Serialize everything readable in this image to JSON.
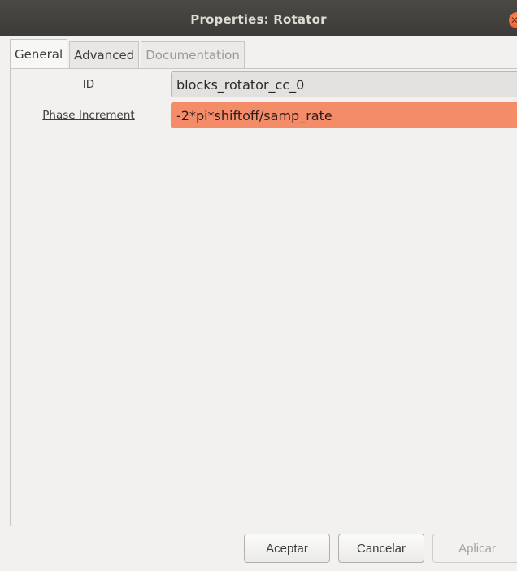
{
  "window": {
    "title": "Properties: Rotator"
  },
  "tabs": [
    {
      "label": "General",
      "state": "active"
    },
    {
      "label": "Advanced",
      "state": "normal"
    },
    {
      "label": "Documentation",
      "state": "disabled"
    }
  ],
  "general": {
    "id_label": "ID",
    "id_value": "blocks_rotator_cc_0",
    "phase_label": "Phase Increment",
    "phase_value": "-2*pi*shiftoff/samp_rate"
  },
  "buttons": {
    "accept": "Aceptar",
    "cancel": "Cancelar",
    "apply": "Aplicar"
  },
  "icons": {
    "close": "close-icon"
  },
  "colors": {
    "titlebar": "#3c3b37",
    "error_field": "#f48c6a",
    "close_button": "#e0521d"
  }
}
